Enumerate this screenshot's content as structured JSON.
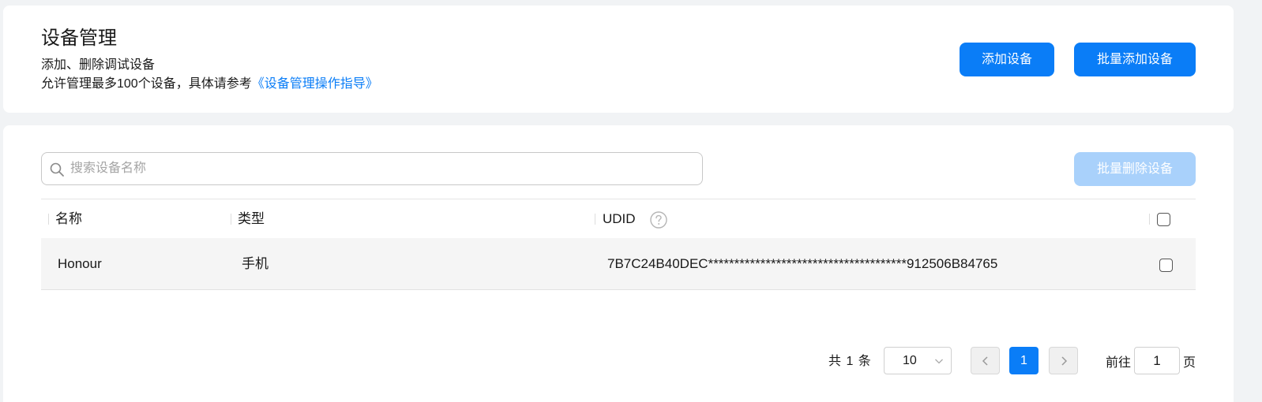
{
  "header": {
    "title": "设备管理",
    "description": "添加、删除调试设备",
    "limit_text": "允许管理最多100个设备，具体请参考",
    "guide_link": "《设备管理操作指导》",
    "add_button": "添加设备",
    "batch_add_button": "批量添加设备"
  },
  "toolbar": {
    "search_placeholder": "搜索设备名称",
    "search_value": "",
    "batch_delete_button": "批量删除设备"
  },
  "table": {
    "columns": [
      "名称",
      "类型",
      "UDID"
    ],
    "rows": [
      {
        "name": "Honour",
        "type": "手机",
        "udid": "7B7C24B40DEC**************************************912506B84765"
      }
    ]
  },
  "pagination": {
    "total_text": "共 1 条",
    "page_size": "10",
    "current_page": "1",
    "goto_prefix": "前往",
    "goto_value": "1",
    "goto_suffix": "页"
  },
  "colors": {
    "primary": "#0a7df7",
    "primary_disabled": "#a9d1fb",
    "background": "#f1f3f5"
  }
}
